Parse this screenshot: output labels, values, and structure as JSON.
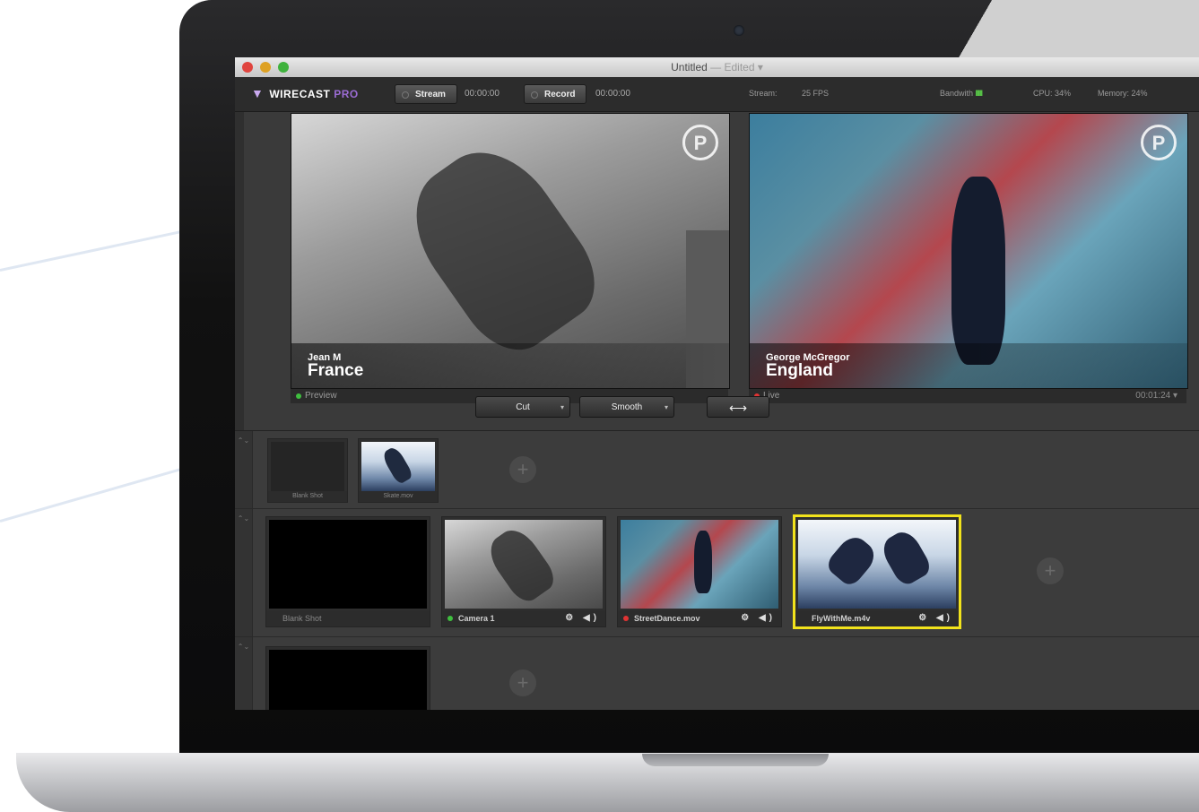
{
  "window": {
    "title": "Untitled",
    "title_edited": "— Edited ▾"
  },
  "toolbar": {
    "app_name": "WIRECAST",
    "app_edition": "PRO",
    "stream_label": "Stream",
    "stream_time": "00:00:00",
    "record_label": "Record",
    "record_time": "00:00:00",
    "stream_status": "Stream:",
    "fps": "25 FPS",
    "bandwidth_label": "Bandwith",
    "bandwidth_bars": "IIIII",
    "cpu": "CPU: 34%",
    "memory": "Memory: 24%"
  },
  "preview": {
    "name": "Jean M",
    "country": "France",
    "status": "Preview",
    "watermark": "P"
  },
  "live": {
    "name": "George McGregor",
    "country": "England",
    "status": "Live",
    "time": "00:01:24 ▾",
    "watermark": "P"
  },
  "transitions": {
    "cut_label": "Cut",
    "smooth_label": "Smooth",
    "swap_label": "⟷",
    "dropdown": "▾"
  },
  "layers": [
    {
      "shots": [
        {
          "label": "Blank Shot"
        },
        {
          "label": "Skate.mov"
        }
      ]
    },
    {
      "shots": [
        {
          "label": "Blank Shot"
        },
        {
          "label": "Camera 1"
        },
        {
          "label": "StreetDance.mov"
        },
        {
          "label": "FlyWithMe.m4v"
        }
      ]
    },
    {
      "shots": []
    }
  ],
  "icons": {
    "add": "+",
    "layer_handle": "⌃⌄",
    "shot_controls": "⚙ ◀)"
  },
  "colors": {
    "preview_indicator": "#3fbf3f",
    "live_indicator": "#e03333",
    "selected_border": "#f2e31c",
    "app_edition": "#9b6cd3"
  }
}
